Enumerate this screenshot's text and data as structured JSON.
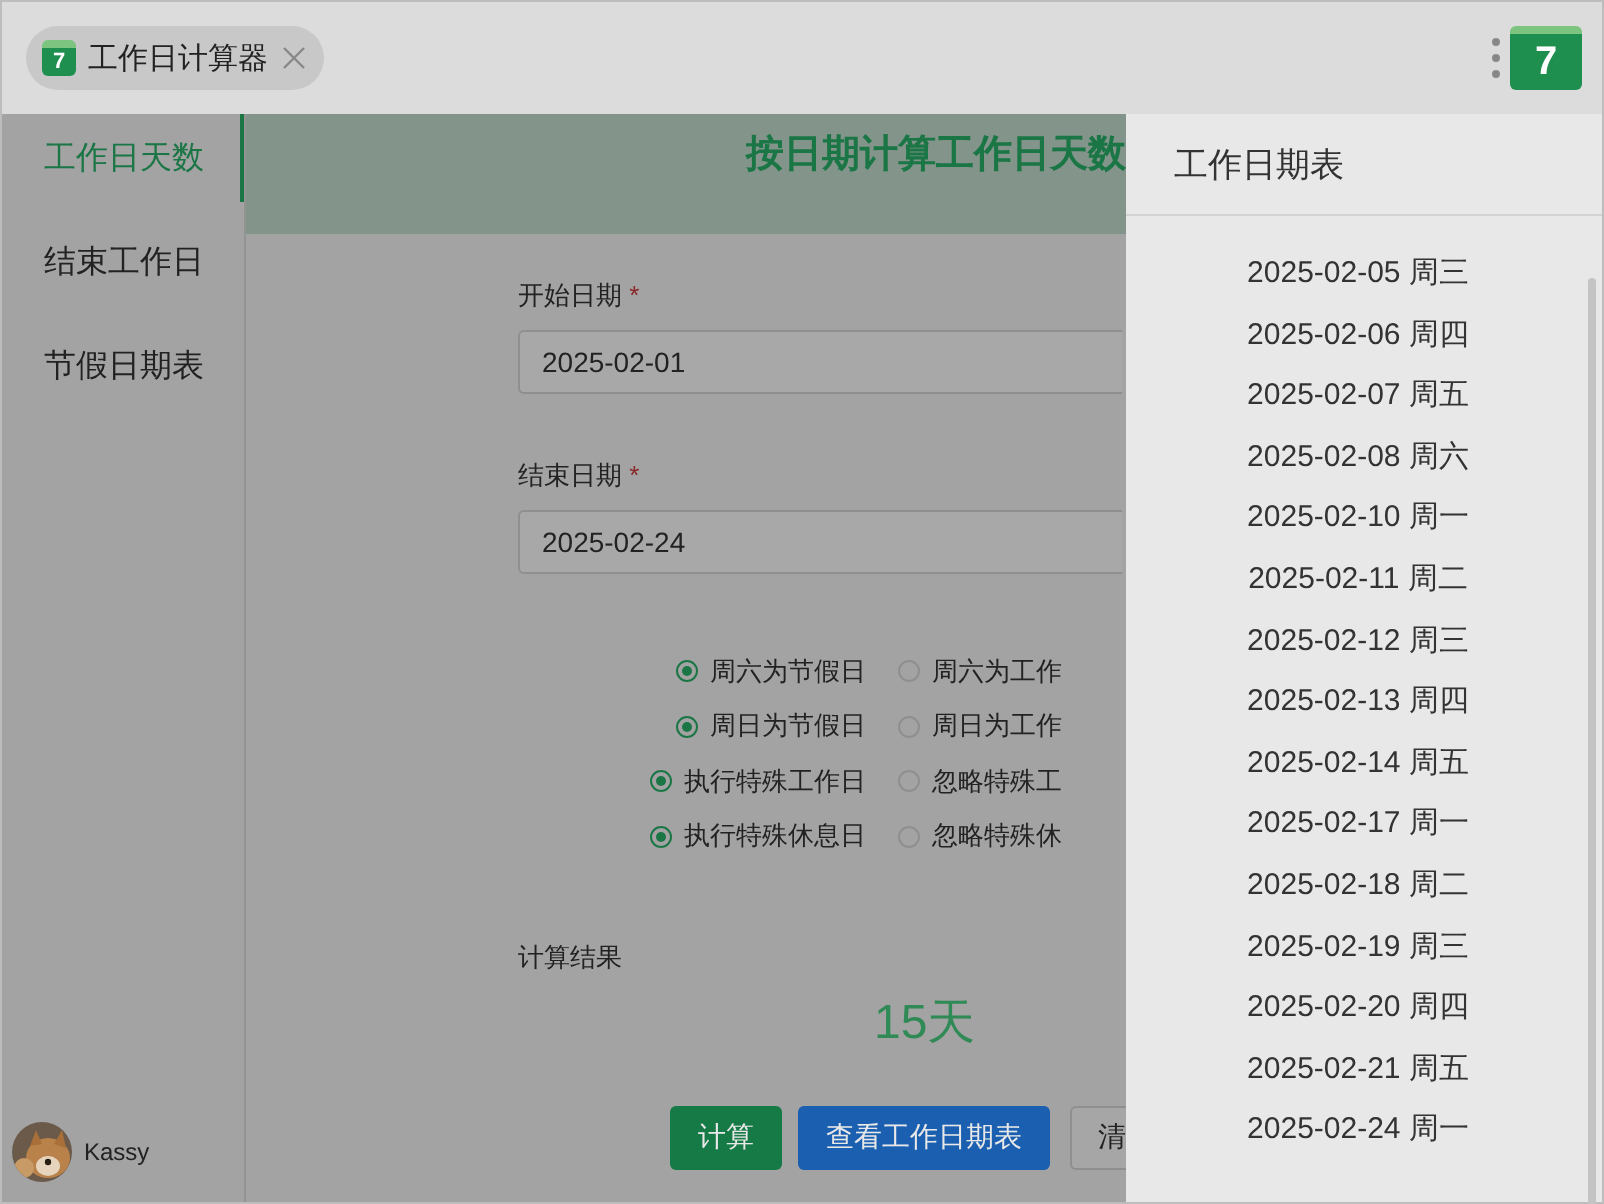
{
  "tab": {
    "icon_label": "7",
    "title": "工作日计算器"
  },
  "toolbar": {
    "app_icon_label": "7"
  },
  "sidebar": {
    "items": [
      {
        "label": "工作日天数",
        "selected": true
      },
      {
        "label": "结束工作日",
        "selected": false
      },
      {
        "label": "节假日期表",
        "selected": false
      }
    ],
    "user": {
      "name": "Kassy"
    }
  },
  "header": {
    "title": "按日期计算工作日天数"
  },
  "form": {
    "fields": [
      {
        "label": "开始日期",
        "mark": "*",
        "value": "2025-02-01"
      },
      {
        "label": "结束日期",
        "mark": "*",
        "value": "2025-02-24"
      }
    ],
    "options": [
      {
        "choices": [
          {
            "label": "周六为节假日",
            "selected": true
          },
          {
            "label": "周六为工作",
            "selected": false
          }
        ]
      },
      {
        "choices": [
          {
            "label": "周日为节假日",
            "selected": true
          },
          {
            "label": "周日为工作",
            "selected": false
          }
        ]
      },
      {
        "choices": [
          {
            "label": "执行特殊工作日",
            "selected": true
          },
          {
            "label": "忽略特殊工",
            "selected": false
          }
        ]
      },
      {
        "choices": [
          {
            "label": "执行特殊休息日",
            "selected": true
          },
          {
            "label": "忽略特殊休",
            "selected": false
          }
        ]
      }
    ],
    "result": {
      "label": "计算结果",
      "value": "15天"
    },
    "buttons": [
      {
        "label": "计算",
        "kind": "success"
      },
      {
        "label": "查看工作日期表",
        "kind": "primary"
      },
      {
        "label": "清",
        "kind": "default"
      }
    ]
  },
  "drawer": {
    "title": "工作日期表",
    "dates": [
      "2025-02-05 周三",
      "2025-02-06 周四",
      "2025-02-07 周五",
      "2025-02-08 周六",
      "2025-02-10 周一",
      "2025-02-11 周二",
      "2025-02-12 周三",
      "2025-02-13 周四",
      "2025-02-14 周五",
      "2025-02-17 周一",
      "2025-02-18 周二",
      "2025-02-19 周三",
      "2025-02-20 周四",
      "2025-02-21 周五",
      "2025-02-24 周一"
    ]
  }
}
